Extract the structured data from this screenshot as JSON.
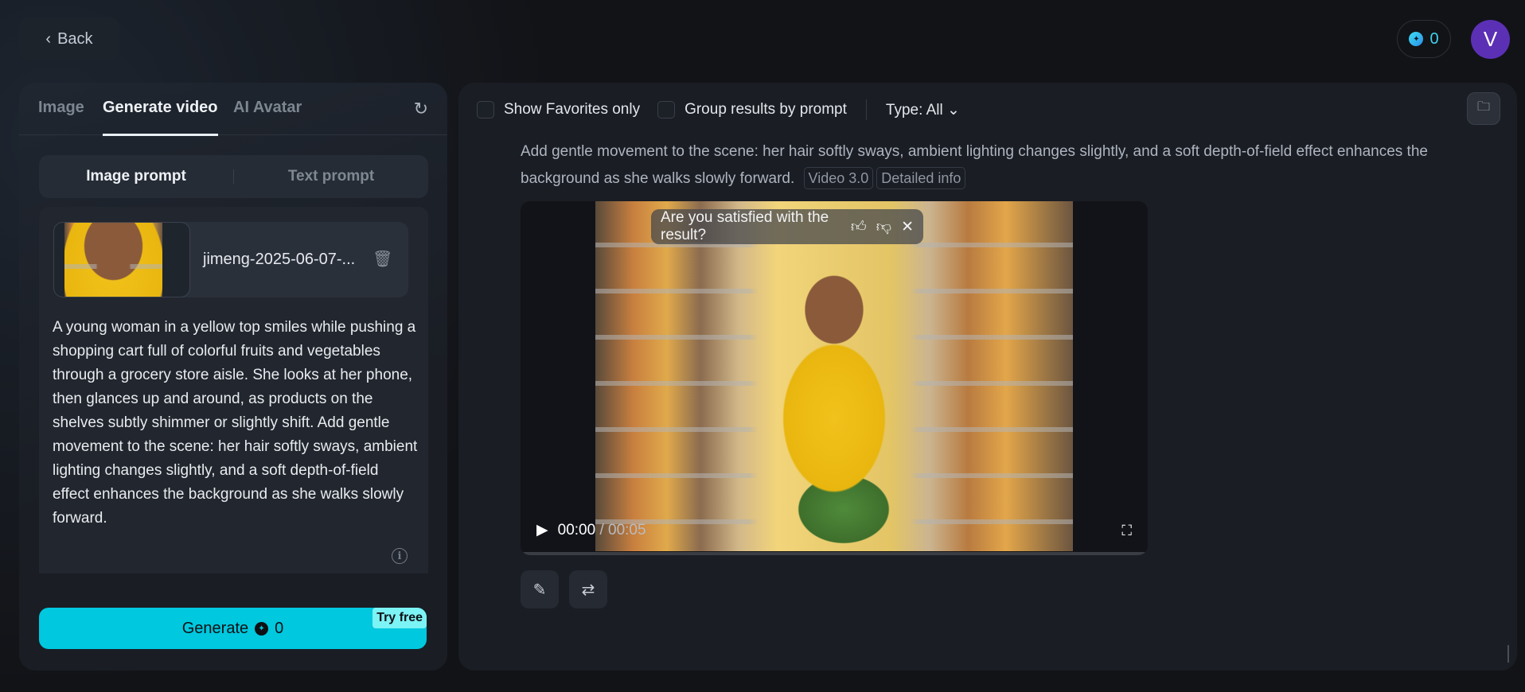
{
  "header": {
    "back_label": "Back",
    "credits": "0",
    "avatar_initial": "V"
  },
  "left": {
    "tabs": [
      {
        "label": "Image"
      },
      {
        "label": "Generate video"
      },
      {
        "label": "AI Avatar"
      }
    ],
    "prompt_modes": [
      "Image prompt",
      "Text prompt"
    ],
    "file_name": "jimeng-2025-06-07-...",
    "prompt": "A young woman in a yellow top smiles while pushing a shopping cart full of colorful fruits and vegetables through a grocery store aisle. She looks at her phone, then glances up and around, as products on the shelves subtly shimmer or slightly shift. Add gentle movement to the scene: her hair softly sways, ambient lighting changes slightly, and a soft depth-of-field effect enhances the background as she walks slowly forward.",
    "generate_label": "Generate",
    "generate_cost": "0",
    "try_free": "Try free"
  },
  "right": {
    "show_favorites": "Show Favorites only",
    "group_results": "Group results by prompt",
    "type_filter": "Type: All",
    "result_prompt": "Add gentle movement to the scene: her hair softly sways, ambient lighting changes slightly, and a soft depth-of-field effect enhances the background as she walks slowly forward.",
    "model_tag": "Video 3.0",
    "detail_tag": "Detailed info",
    "survey": "Are you satisfied with the result?",
    "time_current": "00:00",
    "time_total": "/ 00:05"
  },
  "colors": {
    "accent": "#00c8de",
    "avatar": "#5b30b5"
  }
}
